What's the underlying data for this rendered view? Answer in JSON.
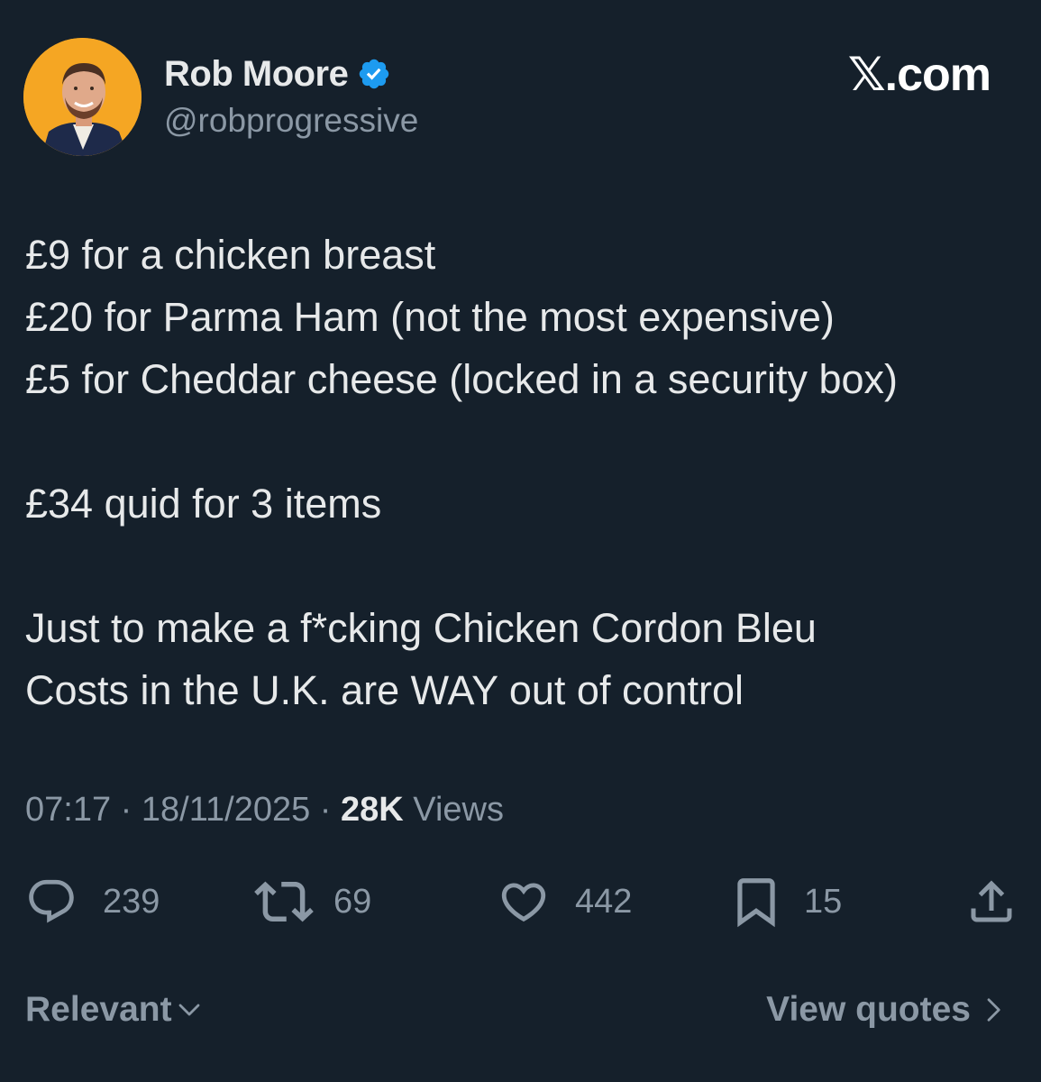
{
  "author": {
    "display_name": "Rob Moore",
    "handle": "@robprogressive",
    "verified": true,
    "avatar_bg": "#f5a623"
  },
  "brand": "𝕏.com",
  "tweet": {
    "lines": [
      "£9 for a chicken breast",
      "£20 for Parma Ham (not the most expensive)",
      "£5 for Cheddar cheese (locked in a security box)",
      "",
      "£34 quid for 3 items",
      "",
      "Just to make a f*cking Chicken Cordon Bleu",
      "Costs in the U.K. are WAY out of control"
    ]
  },
  "meta": {
    "time": "07:17",
    "separator": " · ",
    "date": "18/11/2025",
    "views_count": "28K",
    "views_label": " Views"
  },
  "actions": {
    "replies": "239",
    "reposts": "69",
    "likes": "442",
    "bookmarks": "15"
  },
  "footer": {
    "sort_label": "Relevant",
    "quotes_label": "View quotes"
  },
  "colors": {
    "background": "#15202b",
    "text_primary": "#e7e9ea",
    "text_secondary": "#8b98a5",
    "verified_blue": "#1d9bf0"
  },
  "icons": {
    "reply": "speech-bubble-icon",
    "repost": "repost-arrows-icon",
    "like": "heart-icon",
    "bookmark": "bookmark-icon",
    "share": "share-upload-icon",
    "sort": "chevron-down-icon",
    "quotes": "chevron-right-icon"
  }
}
